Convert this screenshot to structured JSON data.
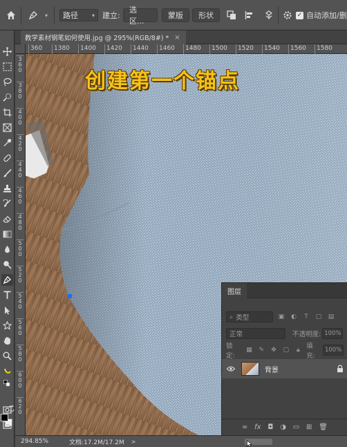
{
  "options_bar": {
    "mode_value": "路径",
    "create_label": "建立:",
    "selection_label": "选区...",
    "mask_label": "蒙版",
    "shape_label": "形状",
    "auto_add_label": "自动添加/删"
  },
  "document_tab": {
    "title": "教学素材钢笔如何使用.jpg @ 295%(RGB/8#) *",
    "close": "×"
  },
  "ruler": {
    "horizontal_ticks": [
      "360",
      "1380",
      "1400",
      "1420",
      "1440",
      "1460",
      "1480",
      "1500",
      "1520",
      "1540",
      "1560",
      "1580"
    ],
    "vertical_ticks": [
      "360",
      "380",
      "400",
      "420",
      "440",
      "460",
      "480",
      "500",
      "520",
      "540",
      "560",
      "580",
      "600",
      "620"
    ]
  },
  "canvas": {
    "overlay_title": "创建第一个锚点"
  },
  "layers_panel": {
    "tab_label": "图层",
    "filter_kind": "类型",
    "blend_mode": "正常",
    "opacity_label": "不透明度:",
    "opacity_value": "100%",
    "lock_label": "锁定:",
    "fill_label": "填充:",
    "fill_value": "100%",
    "layer_name": "背景"
  },
  "status_bar": {
    "zoom": "294.85%",
    "doc_info": "文档:17.2M/17.2M",
    "arrow": ">"
  },
  "colors": {
    "foreground": "#000000",
    "background": "#ffffff",
    "overlay_text": "#f5c21b",
    "anchor_point": "#1e6eff"
  }
}
